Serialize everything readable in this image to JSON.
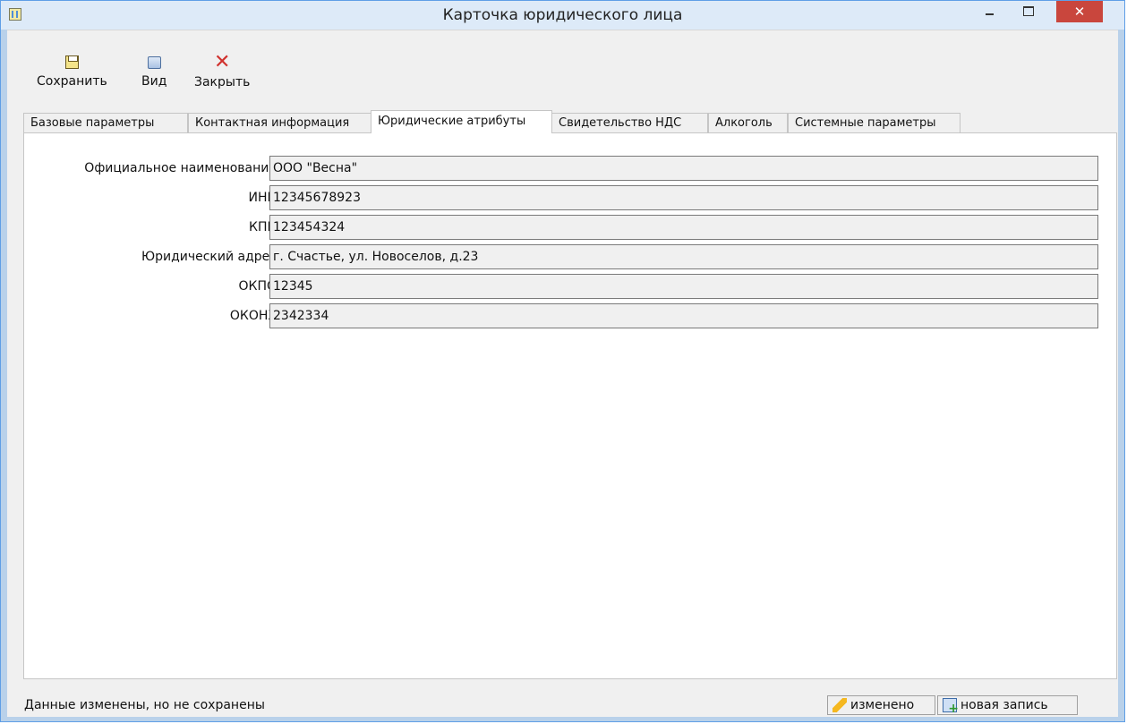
{
  "window": {
    "title": "Карточка юридического лица",
    "minimize_glyph": "",
    "maximize_glyph": "",
    "close_glyph": "✕"
  },
  "toolbar": {
    "save_label": "Сохранить",
    "view_label": "Вид",
    "close_label": "Закрыть"
  },
  "tabs": [
    {
      "label": "Базовые параметры",
      "active": false
    },
    {
      "label": "Контактная информация",
      "active": false
    },
    {
      "label": "Юридические атрибуты",
      "active": true
    },
    {
      "label": "Свидетельство НДС",
      "active": false
    },
    {
      "label": "Алкоголь",
      "active": false
    },
    {
      "label": "Системные параметры",
      "active": false
    }
  ],
  "form": {
    "fields": [
      {
        "label": "Официальное наименование",
        "value": "ООО \"Весна\""
      },
      {
        "label": "ИНН",
        "value": "12345678923"
      },
      {
        "label": "КПП",
        "value": "123454324"
      },
      {
        "label": "Юридический адрес",
        "value": "г. Счастье, ул. Новоселов, д.23"
      },
      {
        "label": "ОКПО",
        "value": "12345"
      },
      {
        "label": "ОКОНХ",
        "value": "2342334"
      }
    ]
  },
  "status": {
    "message": "Данные изменены, но не сохранены",
    "changed_label": "изменено",
    "new_record_label": "новая запись"
  },
  "icons": {
    "save": "floppy-disk-icon",
    "view": "view-icon",
    "close": "close-x-icon",
    "changed": "pencil-icon",
    "new_record": "new-record-icon"
  },
  "colors": {
    "close_button": "#c9463d",
    "close_toolbar_icon": "#d0312d",
    "titlebar": "#ddeaf8",
    "field_background": "#f0f0f0"
  }
}
